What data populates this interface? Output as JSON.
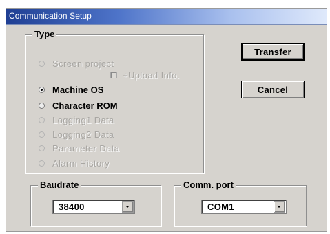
{
  "window": {
    "title": "Communication Setup"
  },
  "type_group": {
    "label": "Type",
    "options": [
      {
        "label": "Screen project",
        "selected": false,
        "enabled": false
      },
      {
        "label": "Machine OS",
        "selected": true,
        "enabled": true
      },
      {
        "label": "Character ROM",
        "selected": false,
        "enabled": true
      },
      {
        "label": "Logging1 Data",
        "selected": false,
        "enabled": false
      },
      {
        "label": "Logging2 Data",
        "selected": false,
        "enabled": false
      },
      {
        "label": "Parameter Data",
        "selected": false,
        "enabled": false
      },
      {
        "label": "Alarm History",
        "selected": false,
        "enabled": false
      }
    ],
    "upload_info": {
      "label": "+Upload Info.",
      "checked": false,
      "enabled": false
    }
  },
  "buttons": {
    "transfer": "Transfer",
    "cancel": "Cancel"
  },
  "baudrate": {
    "label": "Baudrate",
    "value": "38400"
  },
  "comm_port": {
    "label": "Comm. port",
    "value": "COM1"
  },
  "colors": {
    "dialog_bg": "#d6d3ce",
    "titlebar_start": "#1f3f93",
    "titlebar_end": "#dfe9fb",
    "disabled_text": "#a9a7a3"
  }
}
